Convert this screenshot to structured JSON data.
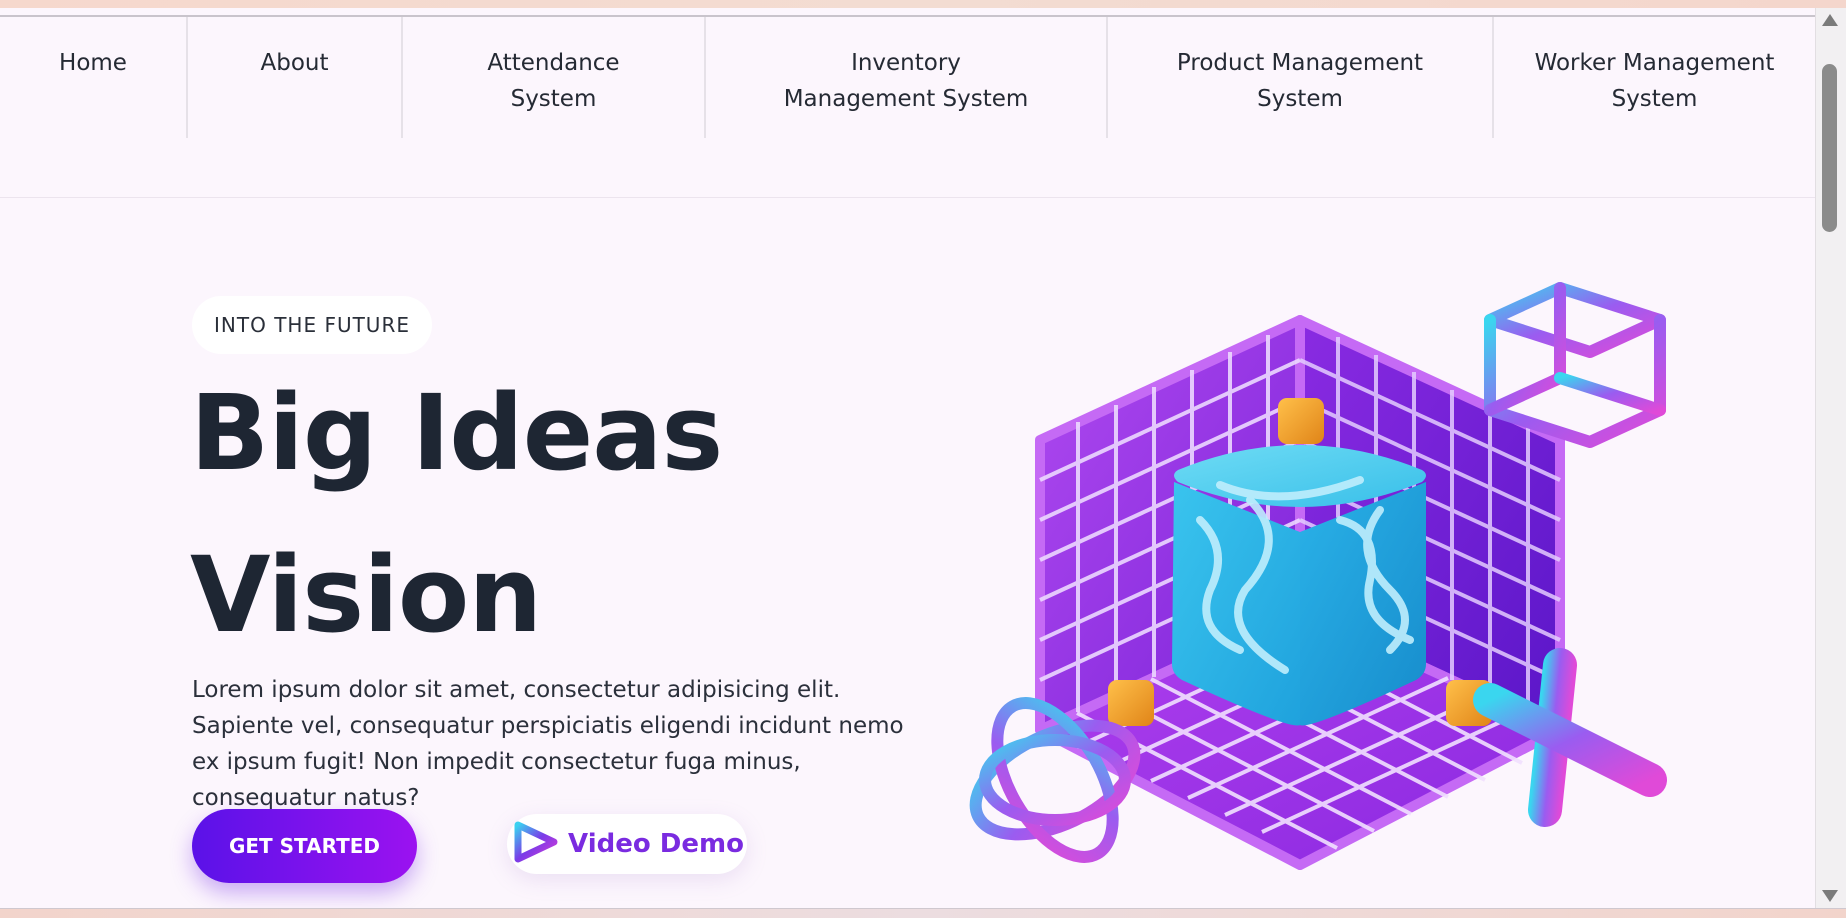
{
  "nav": {
    "items": [
      {
        "label": "Home"
      },
      {
        "label": "About"
      },
      {
        "label": "Attendance\nSystem"
      },
      {
        "label": "Inventory\nManagement System"
      },
      {
        "label": "Product Management\nSystem"
      },
      {
        "label": "Worker Management\nSystem"
      }
    ]
  },
  "hero": {
    "eyebrow": "INTO THE FUTURE",
    "title_line1": "Big Ideas",
    "title_line2": "Vision",
    "description": "Lorem ipsum dolor sit amet, consectetur adipisicing elit. Sapiente vel, consequatur perspiciatis eligendi incidunt nemo ex ipsum fugit! Non impedit consectetur fuga minus, consequatur natus?",
    "cta_primary": "GET STARTED",
    "cta_secondary": "Video Demo",
    "cta_secondary_icon": "play-icon"
  },
  "illustration": {
    "name": "isometric-3d-room",
    "icons": [
      "grid-room",
      "blue-cube",
      "wireframe-cube",
      "atom-rings",
      "cross-tube",
      "orange-cubes"
    ]
  },
  "colors": {
    "page_bg": "#fcf6fd",
    "heading": "#1e2633",
    "cta_gradient_start": "#5a12e8",
    "cta_gradient_end": "#9b12f0",
    "video_demo_text": "#7a2be0",
    "grid_purple": "#9b34e6",
    "cube_blue": "#2fb6ea",
    "orange_accent": "#f0a030"
  }
}
